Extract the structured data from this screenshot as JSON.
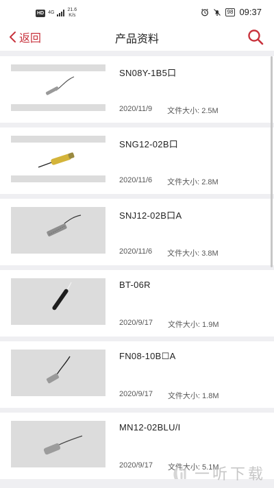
{
  "status_bar": {
    "hd": "HD",
    "net_type": "4G",
    "speed": "21.6",
    "speed_unit": "K/s",
    "battery": "98",
    "time": "09:37"
  },
  "nav": {
    "back_label": "返回",
    "title": "产品资料"
  },
  "products": [
    {
      "name": "SN08Y-1B5口",
      "date": "2020/11/9",
      "size_label": "文件大小: 2.5M"
    },
    {
      "name": "SNG12-02B口",
      "date": "2020/11/6",
      "size_label": "文件大小: 2.8M"
    },
    {
      "name": "SNJ12-02B口A",
      "date": "2020/11/6",
      "size_label": "文件大小: 3.8M"
    },
    {
      "name": "BT-06R",
      "date": "2020/9/17",
      "size_label": "文件大小: 1.9M"
    },
    {
      "name": "FN08-10B☐A",
      "date": "2020/9/17",
      "size_label": "文件大小: 1.8M"
    },
    {
      "name": "MN12-02BLU/I",
      "date": "2020/9/17",
      "size_label": "文件大小: 5.1M"
    }
  ],
  "watermark": "一听下载",
  "colors": {
    "accent": "#c8323c",
    "background": "#efeff2",
    "thumb_gray": "#dcdcdc"
  }
}
